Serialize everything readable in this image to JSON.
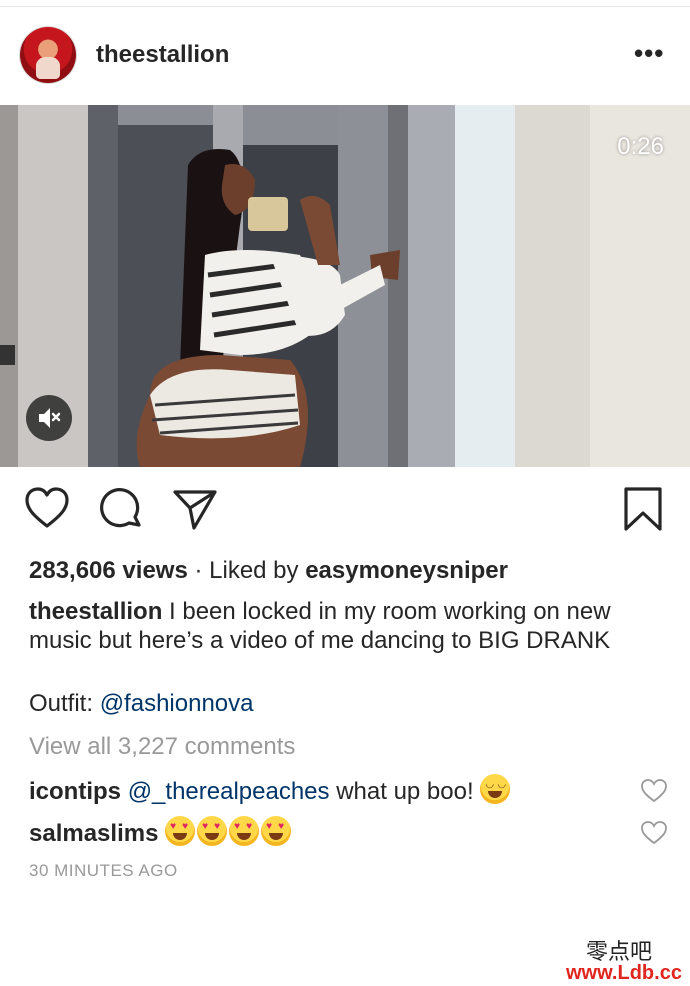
{
  "post": {
    "username": "theestallion",
    "more_label": "•••",
    "video_time": "0:26",
    "views_count": "283,606 views",
    "liked_by_prefix": " · Liked by ",
    "liked_by_user": "easymoneysniper",
    "caption_user": "theestallion",
    "caption_text": " I been locked in my room working on new music but here’s a video of me dancing to BIG DRANK",
    "outfit_label": "Outfit: ",
    "outfit_mention": "@fashionnova",
    "view_all_comments": "View all 3,227 comments",
    "timestamp": "30 MINUTES AGO"
  },
  "comments": [
    {
      "user": "icontips",
      "mention": "@_therealpeaches",
      "text": " what up boo!",
      "emoji": "tears-of-joy"
    },
    {
      "user": "salmaslims",
      "text": "",
      "emoji": "heart-eyes ×4"
    }
  ],
  "icons": {
    "like": "heart-outline-icon",
    "comment": "comment-bubble-icon",
    "share": "paper-plane-icon",
    "save": "bookmark-icon",
    "mute": "speaker-muted-icon"
  },
  "watermark": {
    "line1": "零点吧",
    "line2": "www.Ldb.cc"
  },
  "colors": {
    "text": "#262626",
    "muted": "#999999",
    "mention": "#003569",
    "watermark": "#e0261f"
  }
}
